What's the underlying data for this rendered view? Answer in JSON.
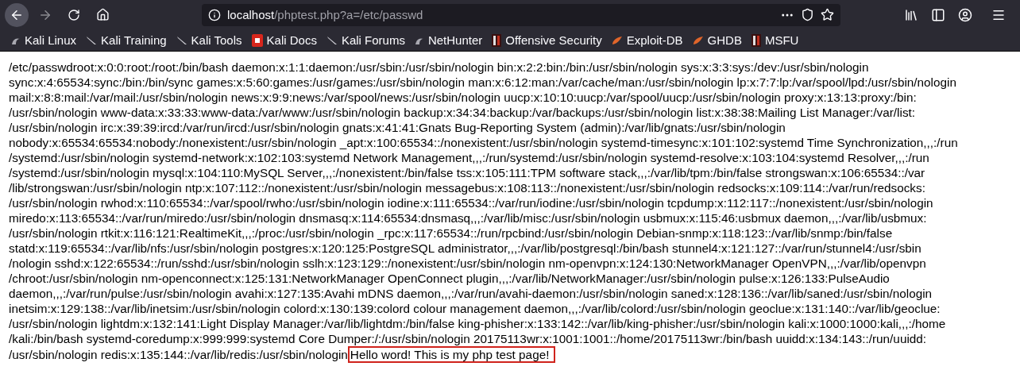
{
  "nav_buttons": [
    {
      "kind": "back",
      "disabled": false
    },
    {
      "kind": "forward",
      "disabled": true
    },
    {
      "kind": "reload",
      "disabled": false
    },
    {
      "kind": "home",
      "disabled": false
    }
  ],
  "address_bar": {
    "host": "localhost",
    "path": "/phptest.php?a=/etc/passwd"
  },
  "bookmarks": [
    {
      "label": "Kali Linux",
      "kind": "kali"
    },
    {
      "label": "Kali Training",
      "kind": "kali-tool"
    },
    {
      "label": "Kali Tools",
      "kind": "kali-tool"
    },
    {
      "label": "Kali Docs",
      "kind": "docs"
    },
    {
      "label": "Kali Forums",
      "kind": "kali-tool"
    },
    {
      "label": "NetHunter",
      "kind": "kali"
    },
    {
      "label": "Offensive Security",
      "kind": "offsec"
    },
    {
      "label": "Exploit-DB",
      "kind": "exploit"
    },
    {
      "label": "GHDB",
      "kind": "exploit"
    },
    {
      "label": "MSFU",
      "kind": "offsec"
    }
  ],
  "page": {
    "lines": [
      "/etc/passwdroot:x:0:0:root:/root:/bin/bash daemon:x:1:1:daemon:/usr/sbin:/usr/sbin/nologin bin:x:2:2:bin:/bin:/usr/sbin/nologin sys:x:3:3:sys:/dev:/usr/sbin/nologin",
      "sync:x:4:65534:sync:/bin:/bin/sync games:x:5:60:games:/usr/games:/usr/sbin/nologin man:x:6:12:man:/var/cache/man:/usr/sbin/nologin lp:x:7:7:lp:/var/spool/lpd:/usr/sbin/nologin",
      "mail:x:8:8:mail:/var/mail:/usr/sbin/nologin news:x:9:9:news:/var/spool/news:/usr/sbin/nologin uucp:x:10:10:uucp:/var/spool/uucp:/usr/sbin/nologin proxy:x:13:13:proxy:/bin:",
      "/usr/sbin/nologin www-data:x:33:33:www-data:/var/www:/usr/sbin/nologin backup:x:34:34:backup:/var/backups:/usr/sbin/nologin list:x:38:38:Mailing List Manager:/var/list:",
      "/usr/sbin/nologin irc:x:39:39:ircd:/var/run/ircd:/usr/sbin/nologin gnats:x:41:41:Gnats Bug-Reporting System (admin):/var/lib/gnats:/usr/sbin/nologin",
      "nobody:x:65534:65534:nobody:/nonexistent:/usr/sbin/nologin _apt:x:100:65534::/nonexistent:/usr/sbin/nologin systemd-timesync:x:101:102:systemd Time Synchronization,,,:/run",
      "/systemd:/usr/sbin/nologin systemd-network:x:102:103:systemd Network Management,,,:/run/systemd:/usr/sbin/nologin systemd-resolve:x:103:104:systemd Resolver,,,:/run",
      "/systemd:/usr/sbin/nologin mysql:x:104:110:MySQL Server,,,:/nonexistent:/bin/false tss:x:105:111:TPM software stack,,,:/var/lib/tpm:/bin/false strongswan:x:106:65534::/var",
      "/lib/strongswan:/usr/sbin/nologin ntp:x:107:112::/nonexistent:/usr/sbin/nologin messagebus:x:108:113::/nonexistent:/usr/sbin/nologin redsocks:x:109:114::/var/run/redsocks:",
      "/usr/sbin/nologin rwhod:x:110:65534::/var/spool/rwho:/usr/sbin/nologin iodine:x:111:65534::/var/run/iodine:/usr/sbin/nologin tcpdump:x:112:117::/nonexistent:/usr/sbin/nologin",
      "miredo:x:113:65534::/var/run/miredo:/usr/sbin/nologin dnsmasq:x:114:65534:dnsmasq,,,:/var/lib/misc:/usr/sbin/nologin usbmux:x:115:46:usbmux daemon,,,:/var/lib/usbmux:",
      "/usr/sbin/nologin rtkit:x:116:121:RealtimeKit,,,:/proc:/usr/sbin/nologin _rpc:x:117:65534::/run/rpcbind:/usr/sbin/nologin Debian-snmp:x:118:123::/var/lib/snmp:/bin/false",
      "statd:x:119:65534::/var/lib/nfs:/usr/sbin/nologin postgres:x:120:125:PostgreSQL administrator,,,:/var/lib/postgresql:/bin/bash stunnel4:x:121:127::/var/run/stunnel4:/usr/sbin",
      "/nologin sshd:x:122:65534::/run/sshd:/usr/sbin/nologin sslh:x:123:129::/nonexistent:/usr/sbin/nologin nm-openvpn:x:124:130:NetworkManager OpenVPN,,,:/var/lib/openvpn",
      "/chroot:/usr/sbin/nologin nm-openconnect:x:125:131:NetworkManager OpenConnect plugin,,,:/var/lib/NetworkManager:/usr/sbin/nologin pulse:x:126:133:PulseAudio",
      "daemon,,,:/var/run/pulse:/usr/sbin/nologin avahi:x:127:135:Avahi mDNS daemon,,,:/var/run/avahi-daemon:/usr/sbin/nologin saned:x:128:136::/var/lib/saned:/usr/sbin/nologin",
      "inetsim:x:129:138::/var/lib/inetsim:/usr/sbin/nologin colord:x:130:139:colord colour management daemon,,,:/var/lib/colord:/usr/sbin/nologin geoclue:x:131:140::/var/lib/geoclue:",
      "/usr/sbin/nologin lightdm:x:132:141:Light Display Manager:/var/lib/lightdm:/bin/false king-phisher:x:133:142::/var/lib/king-phisher:/usr/sbin/nologin kali:x:1000:1000:kali,,,:/home",
      "/kali:/bin/bash systemd-coredump:x:999:999:systemd Core Dumper:/:/usr/sbin/nologin 20175113wr:x:1001:1001::/home/20175113wr:/bin/bash uuidd:x:134:143::/run/uuidd:",
      "/usr/sbin/nologin redis:x:135:144::/var/lib/redis:/usr/sbin/nologin"
    ],
    "highlight": "Hello word! This is my php test page!"
  }
}
